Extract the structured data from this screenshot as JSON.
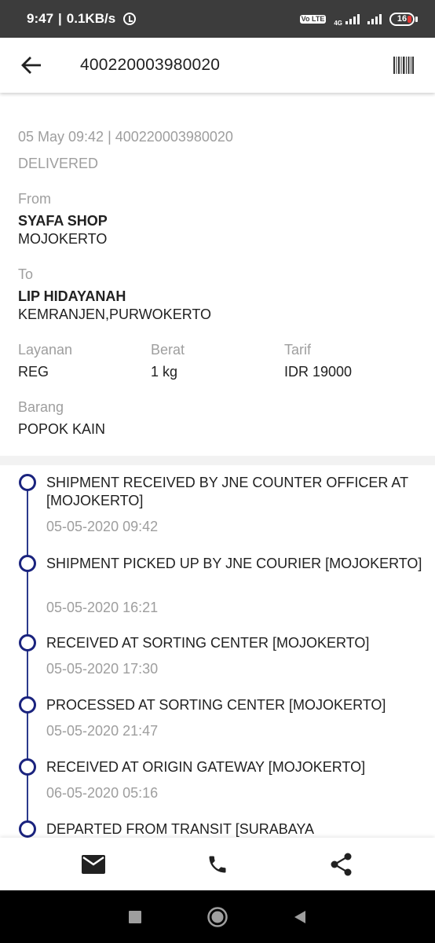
{
  "status_bar": {
    "time": "9:47",
    "speed": "0.1KB/s",
    "volte": "Vo LTE",
    "network": "4G",
    "battery": "16"
  },
  "app_bar": {
    "title": "400220003980020",
    "icons": {
      "back": "arrow-back-icon",
      "barcode": "barcode-icon"
    }
  },
  "shipment": {
    "meta": "05 May 09:42 | 400220003980020",
    "status": "DELIVERED",
    "from_label": "From",
    "from_name": "SYAFA SHOP",
    "from_city": "MOJOKERTO",
    "to_label": "To",
    "to_name": "LIP HIDAYANAH",
    "to_city": "KEMRANJEN,PURWOKERTO",
    "service_label": "Layanan",
    "service_value": "REG",
    "weight_label": "Berat",
    "weight_value": "1 kg",
    "rate_label": "Tarif",
    "rate_value": "IDR 19000",
    "goods_label": "Barang",
    "goods_value": "POPOK KAIN"
  },
  "timeline": [
    {
      "title": "SHIPMENT RECEIVED BY JNE COUNTER OFFICER AT [MOJOKERTO]",
      "time": "05-05-2020 09:42"
    },
    {
      "title": "SHIPMENT PICKED UP BY JNE COURIER [MOJOKERTO]",
      "time": "05-05-2020 16:21"
    },
    {
      "title": "RECEIVED AT SORTING CENTER [MOJOKERTO]",
      "time": "05-05-2020 17:30"
    },
    {
      "title": "PROCESSED AT SORTING CENTER [MOJOKERTO]",
      "time": "05-05-2020 21:47"
    },
    {
      "title": "RECEIVED AT ORIGIN GATEWAY [MOJOKERTO]",
      "time": "06-05-2020 05:16"
    },
    {
      "title": "DEPARTED FROM TRANSIT [SURABAYA",
      "time": ""
    }
  ],
  "actions": {
    "icons": [
      "mail-icon",
      "phone-icon",
      "share-icon"
    ]
  },
  "nav": {
    "icons": [
      "recents-square-icon",
      "home-circle-icon",
      "back-triangle-icon"
    ]
  },
  "colors": {
    "timeline_accent": "#1a237e",
    "muted_text": "#9e9e9e",
    "primary_text": "#212121"
  }
}
